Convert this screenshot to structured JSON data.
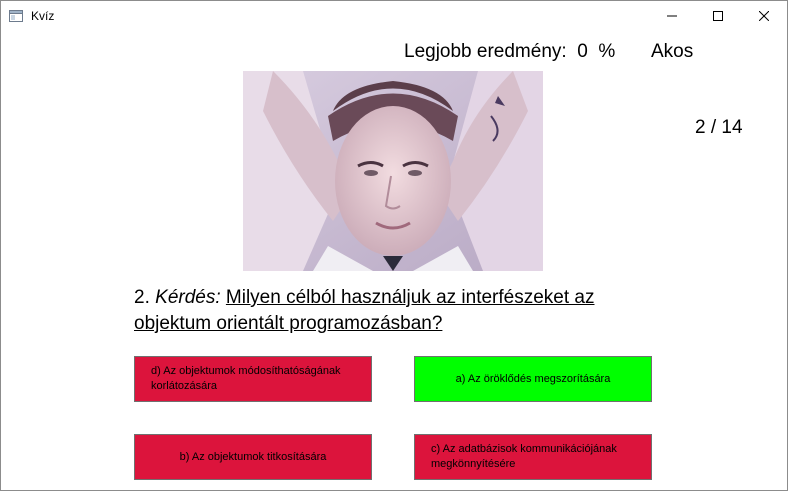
{
  "window": {
    "title": "Kvíz",
    "icon": "app-window-icon",
    "controls": [
      "minimize-icon",
      "maximize-icon",
      "close-icon"
    ]
  },
  "header": {
    "best_score_label": "Legjobb eredmény:",
    "best_score_value": "0",
    "best_score_unit": "%",
    "user_name": "Akos"
  },
  "progress": "2 / 14",
  "question": {
    "number": "2.",
    "label": "Kérdés:",
    "text": "Milyen célból használjuk az interfészeket az objektum orientált programozásban?"
  },
  "answers": [
    {
      "label": "d) Az objektumok módosíthatóságának korlátozására",
      "color": "#dc143c",
      "state": "wrong"
    },
    {
      "label": "a) Az öröklődés megszorítására",
      "color": "#00ff00",
      "state": "correct"
    },
    {
      "label": "b) Az objektumok titkosítására",
      "color": "#dc143c",
      "state": "wrong"
    },
    {
      "label": "c) Az adatbázisok kommunikációjának megkönnyítésére",
      "color": "#dc143c",
      "state": "wrong"
    }
  ]
}
